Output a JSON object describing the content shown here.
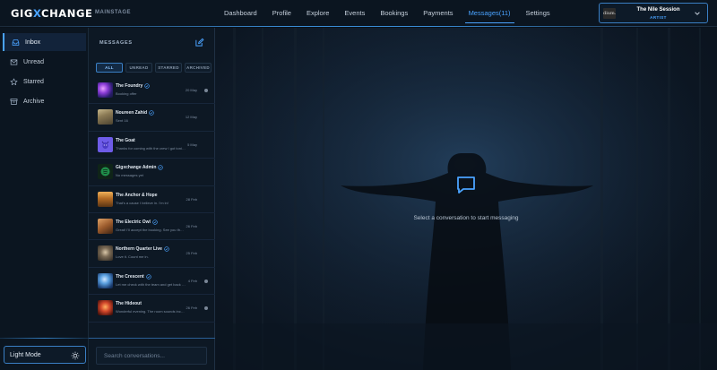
{
  "brand": {
    "logo_left": "GIG",
    "logo_x": "X",
    "logo_right": "CHANGE",
    "subtitle": "MAINSTAGE"
  },
  "nav": {
    "items": [
      {
        "label": "Dashboard"
      },
      {
        "label": "Profile"
      },
      {
        "label": "Explore"
      },
      {
        "label": "Events"
      },
      {
        "label": "Bookings"
      },
      {
        "label": "Payments"
      },
      {
        "label": "Messages",
        "badge": "(11)",
        "active": true
      },
      {
        "label": "Settings"
      }
    ]
  },
  "user": {
    "avatar_text": "dium.",
    "name": "The Nile Session",
    "role": "ARTIST"
  },
  "sidebar": {
    "items": [
      {
        "label": "Inbox",
        "icon": "inbox-icon",
        "active": true
      },
      {
        "label": "Unread",
        "icon": "mail-icon"
      },
      {
        "label": "Starred",
        "icon": "star-icon"
      },
      {
        "label": "Archive",
        "icon": "archive-icon"
      }
    ],
    "light_mode_label": "Light Mode"
  },
  "messages": {
    "title": "MESSAGES",
    "filters": [
      "ALL",
      "UNREAD",
      "STARRED",
      "ARCHIVED"
    ],
    "active_filter": "ALL",
    "conversations": [
      {
        "name": "The Foundry",
        "preview": "Booking offer",
        "date": "20 May",
        "verified": true,
        "unread": true
      },
      {
        "name": "Noureen Zahid",
        "preview": "Sent 16",
        "date": "12 May",
        "verified": true,
        "unread": false
      },
      {
        "name": "The Goat",
        "preview": "Thanks for coming with the crew I got tonight.",
        "date": "5 May",
        "verified": false,
        "unread": false
      },
      {
        "name": "Gigxchange Admin",
        "preview": "No messages yet",
        "date": "",
        "verified": true,
        "unread": false
      },
      {
        "name": "The Anchor & Hope",
        "preview": "That's a cause I believe in. I'm in!",
        "date": "28 Feb",
        "verified": false,
        "unread": false
      },
      {
        "name": "The Electric Owl",
        "preview": "Great! I'll accept the booking. See you there.",
        "date": "26 Feb",
        "verified": true,
        "unread": false
      },
      {
        "name": "Northern Quarter Live",
        "preview": "Love it. Count me in.",
        "date": "25 Feb",
        "verified": true,
        "unread": false
      },
      {
        "name": "The Crescent",
        "preview": "Let me check with the team and get back to you.",
        "date": "4 Feb",
        "verified": true,
        "unread": true
      },
      {
        "name": "The Hideout",
        "preview": "Wonderful evening. The room sounds incredible.",
        "date": "26 Feb",
        "verified": false,
        "unread": true
      }
    ],
    "search_placeholder": "Search conversations..."
  },
  "main": {
    "empty_state": "Select a conversation to start messaging"
  },
  "colors": {
    "accent": "#4aa3ff",
    "background": "#0a121c",
    "panel": "#0d1824"
  }
}
